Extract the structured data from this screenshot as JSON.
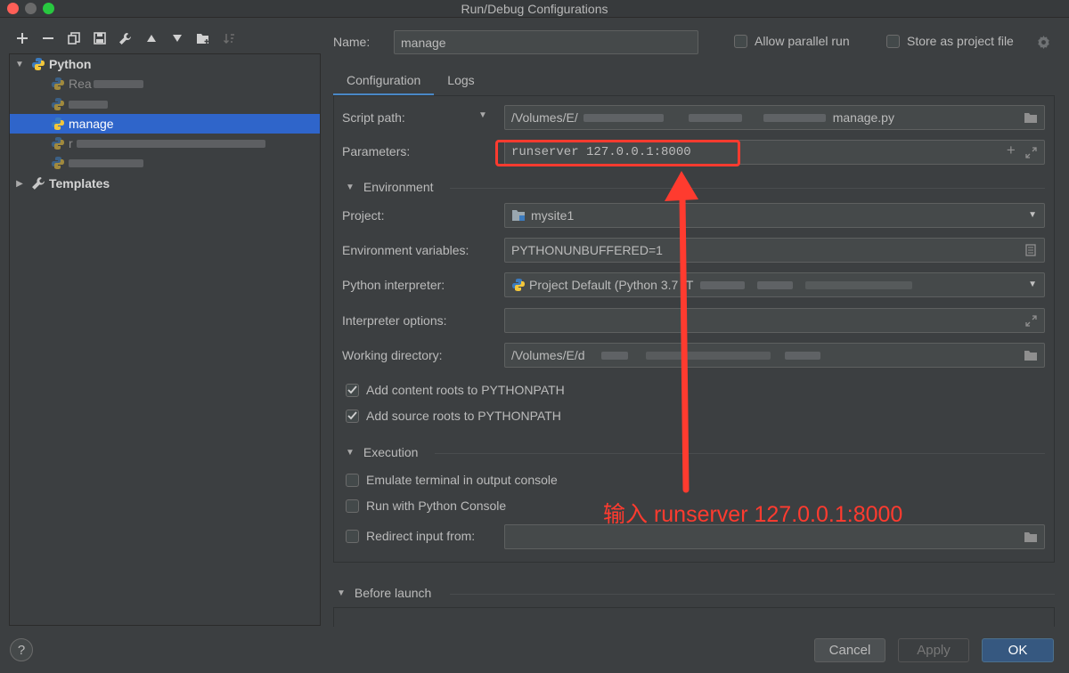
{
  "window": {
    "title": "Run/Debug Configurations"
  },
  "toolbar": {
    "icons": [
      "plus-icon",
      "minus-icon",
      "copy-icon",
      "save-icon",
      "wrench-icon",
      "arrow-up-icon",
      "arrow-down-icon",
      "folder-add-icon",
      "sort-icon"
    ]
  },
  "tree": {
    "python_label": "Python",
    "items": [
      {
        "label": "Rea",
        "obscured": true
      },
      {
        "label": "",
        "obscured": true
      },
      {
        "label": "manage",
        "selected": true
      },
      {
        "label": "r",
        "obscured": true
      },
      {
        "label": "",
        "obscured": true
      }
    ],
    "templates_label": "Templates"
  },
  "header": {
    "name_label": "Name:",
    "name_value": "manage",
    "parallel_label": "Allow parallel run",
    "store_label": "Store as project file"
  },
  "tabs": [
    {
      "label": "Configuration",
      "active": true
    },
    {
      "label": "Logs",
      "active": false
    }
  ],
  "form": {
    "script_path_label": "Script path:",
    "script_path_value": "/Volumes/E/",
    "script_path_tail": "manage.py",
    "parameters_label": "Parameters:",
    "parameters_value": "runserver 127.0.0.1:8000",
    "environment_section": "Environment",
    "project_label": "Project:",
    "project_value": "mysite1",
    "env_vars_label": "Environment variables:",
    "env_vars_value": "PYTHONUNBUFFERED=1",
    "interpreter_label": "Python interpreter:",
    "interpreter_value": "Project Default (Python 3.7 (T",
    "interp_options_label": "Interpreter options:",
    "interp_options_value": "",
    "working_dir_label": "Working directory:",
    "working_dir_value": "/Volumes/E/d",
    "add_content_roots": "Add content roots to PYTHONPATH",
    "add_source_roots": "Add source roots to PYTHONPATH",
    "execution_section": "Execution",
    "emulate_terminal": "Emulate terminal in output console",
    "run_python_console": "Run with Python Console",
    "redirect_input": "Redirect input from:",
    "redirect_value": ""
  },
  "before_launch": "Before launch",
  "buttons": {
    "cancel": "Cancel",
    "apply": "Apply",
    "ok": "OK",
    "help": "?"
  },
  "annotation": {
    "text": "输入 runserver 127.0.0.1:8000",
    "color": "#ff3b2f"
  },
  "colors": {
    "background": "#3c3f41",
    "selection": "#2f65ca",
    "primary_button": "#365880",
    "annotation": "#ff3b2f"
  }
}
